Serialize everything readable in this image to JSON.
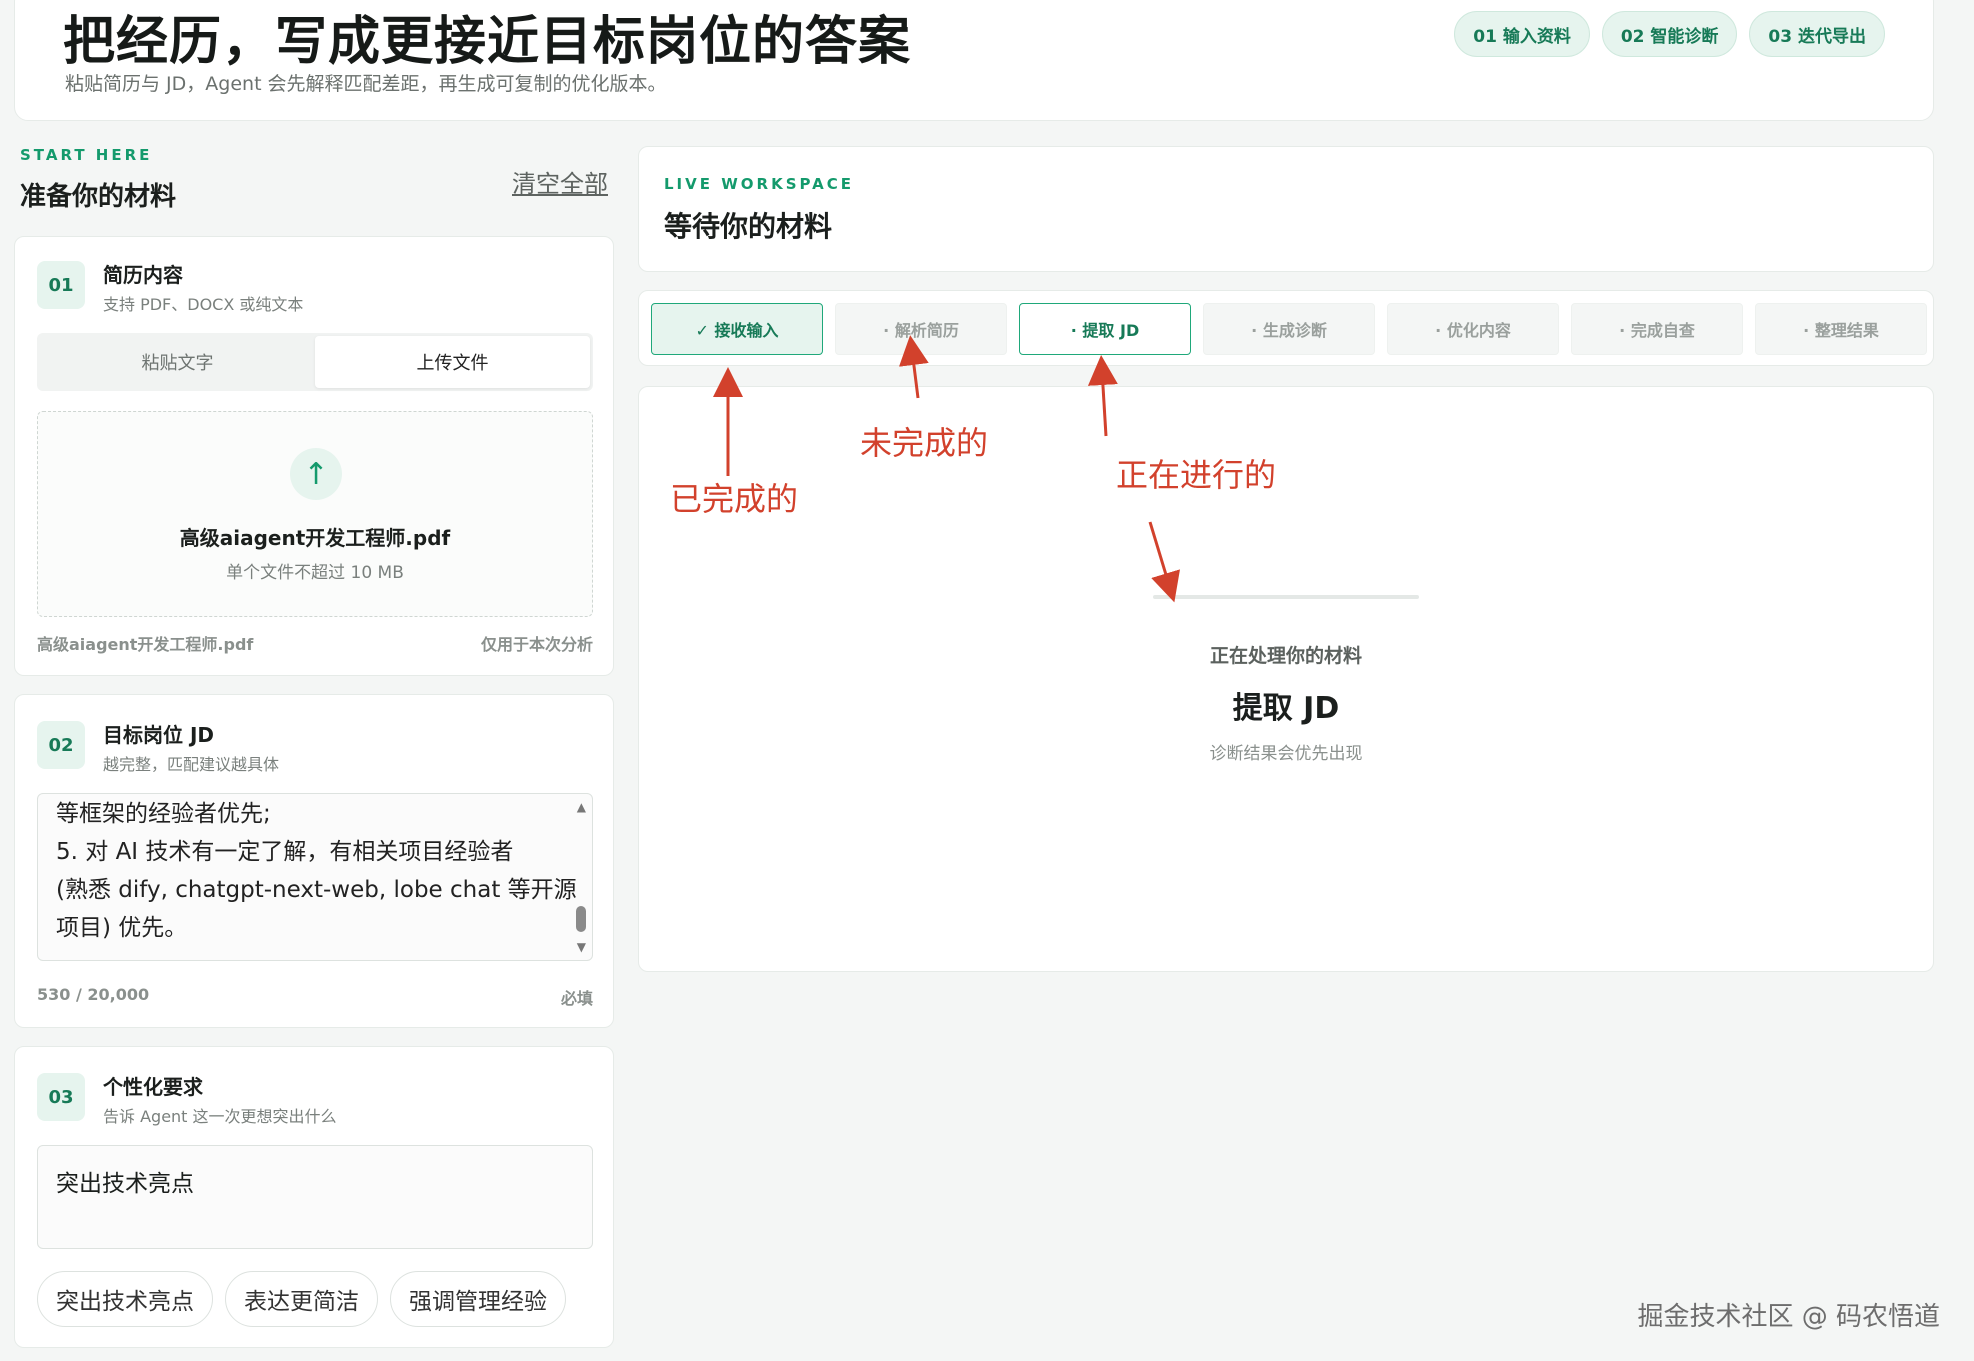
{
  "header": {
    "title": "把经历，写成更接近目标岗位的答案",
    "subtitle": "粘贴简历与 JD，Agent 会先解释匹配差距，再生成可复制的优化版本。",
    "steps": [
      "01 输入资料",
      "02 智能诊断",
      "03 迭代导出"
    ]
  },
  "left": {
    "kicker": "START HERE",
    "title": "准备你的材料",
    "clear_label": "清空全部",
    "resume": {
      "num": "01",
      "title": "简历内容",
      "subtitle": "支持 PDF、DOCX 或纯文本",
      "tabs": [
        "粘贴文字",
        "上传文件"
      ],
      "active_tab": "上传文件",
      "file_name": "高级aiagent开发工程师.pdf",
      "file_hint": "单个文件不超过 10 MB",
      "footer_file": "高级aiagent开发工程师.pdf",
      "footer_note": "仅用于本次分析"
    },
    "jd": {
      "num": "02",
      "title": "目标岗位 JD",
      "subtitle": "越完整，匹配建议越具体",
      "lines": [
        "等框架的经验者优先;",
        "5. 对 AI 技术有一定了解，有相关项目经验者",
        "(熟悉 dify, chatgpt-next-web, lobe chat 等开源",
        "项目) 优先。"
      ],
      "count": "530 / 20,000",
      "required": "必填"
    },
    "custom": {
      "num": "03",
      "title": "个性化要求",
      "subtitle": "告诉 Agent 这一次更想突出什么",
      "value": "突出技术亮点",
      "chips": [
        "突出技术亮点",
        "表达更简洁",
        "强调管理经验"
      ]
    }
  },
  "right": {
    "kicker": "LIVE WORKSPACE",
    "title": "等待你的材料",
    "pipeline": [
      {
        "label": "✓ 接收输入",
        "state": "done"
      },
      {
        "label": "· 解析简历",
        "state": "pending"
      },
      {
        "label": "· 提取 JD",
        "state": "current"
      },
      {
        "label": "· 生成诊断",
        "state": "pending"
      },
      {
        "label": "· 优化内容",
        "state": "pending"
      },
      {
        "label": "· 完成自查",
        "state": "pending"
      },
      {
        "label": "· 整理结果",
        "state": "pending"
      }
    ],
    "stage_label": "正在处理你的材料",
    "stage_current": "提取 JD",
    "stage_hint": "诊断结果会优先出现"
  },
  "annotations": {
    "done": "已完成的",
    "pending": "未完成的",
    "current": "正在进行的",
    "color": "#d2412c"
  },
  "watermark": "掘金技术社区 @ 码农悟道",
  "colors": {
    "accent": "#149a6c",
    "accent_bg": "#e6f4ee"
  }
}
